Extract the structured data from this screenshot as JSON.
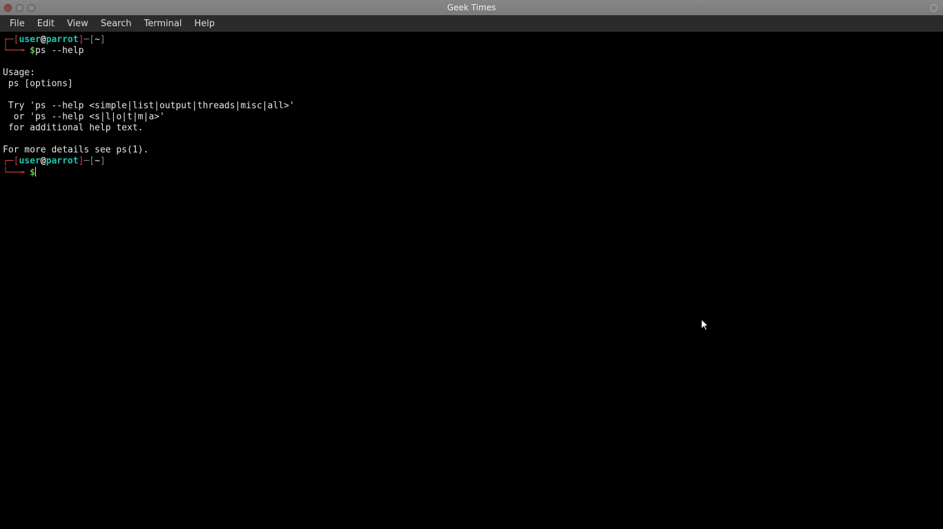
{
  "titlebar": {
    "title": "Geek Times"
  },
  "menubar": {
    "items": [
      "File",
      "Edit",
      "View",
      "Search",
      "Terminal",
      "Help"
    ]
  },
  "prompt": {
    "open_bracket": "┌─[",
    "user": "user",
    "at": "@",
    "host": "parrot",
    "close_bracket": "]",
    "dash": "─",
    "path_open": "[",
    "path": "~",
    "path_close": "]",
    "lower": "└──╼ ",
    "dollar": "$"
  },
  "session": {
    "cmd1": "ps --help",
    "output": [
      "",
      "Usage:",
      " ps [options]",
      "",
      " Try 'ps --help <simple|list|output|threads|misc|all>'",
      "  or 'ps --help <s|l|o|t|m|a>'",
      " for additional help text.",
      "",
      "For more details see ps(1)."
    ]
  },
  "colors": {
    "prompt_bracket": "#d43f3f",
    "user_host": "#20c7b0",
    "path": "#888",
    "dollar": "#6fbf4a",
    "text": "#e8e8e8"
  }
}
